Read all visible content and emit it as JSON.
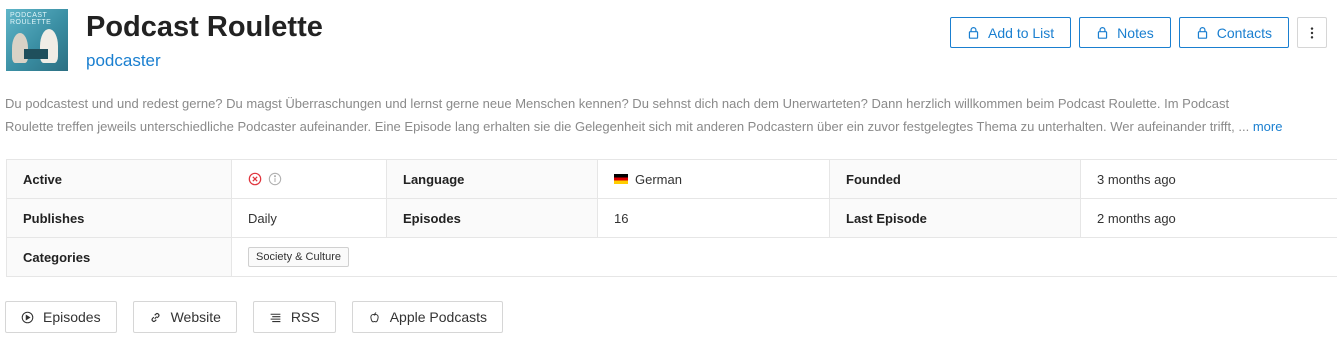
{
  "podcast": {
    "title": "Podcast Roulette",
    "subtitle": "podcaster",
    "cover_text_line1": "PODCAST",
    "cover_text_line2": "ROULETTE"
  },
  "actions": {
    "add_to_list": "Add to List",
    "notes": "Notes",
    "contacts": "Contacts",
    "more_icon": "kebab-menu-icon"
  },
  "description": {
    "line1": "Du podcastest und und redest gerne? Du magst Überraschungen und lernst gerne neue Menschen kennen? Du sehnst dich nach dem Unerwarteten? Dann herzlich willkommen beim Podcast Roulette. Im Podcast",
    "line2": "Roulette treffen jeweils unterschiedliche Podcaster aufeinander. Eine Episode lang erhalten sie die Gelegenheit sich mit anderen Podcastern über ein zuvor festgelegtes Thema zu unterhalten. Wer aufeinander trifft, ...",
    "more": "more"
  },
  "info": {
    "active_label": "Active",
    "language_label": "Language",
    "language_value": "German",
    "founded_label": "Founded",
    "founded_value": "3 months ago",
    "publishes_label": "Publishes",
    "publishes_value": "Daily",
    "episodes_label": "Episodes",
    "episodes_value": "16",
    "last_episode_label": "Last Episode",
    "last_episode_value": "2 months ago",
    "categories_label": "Categories",
    "categories": [
      "Society & Culture"
    ]
  },
  "links": {
    "episodes": "Episodes",
    "website": "Website",
    "rss": "RSS",
    "apple_podcasts": "Apple Podcasts"
  },
  "colors": {
    "accent": "#1a7fd0",
    "inactive": "#e0343c"
  }
}
